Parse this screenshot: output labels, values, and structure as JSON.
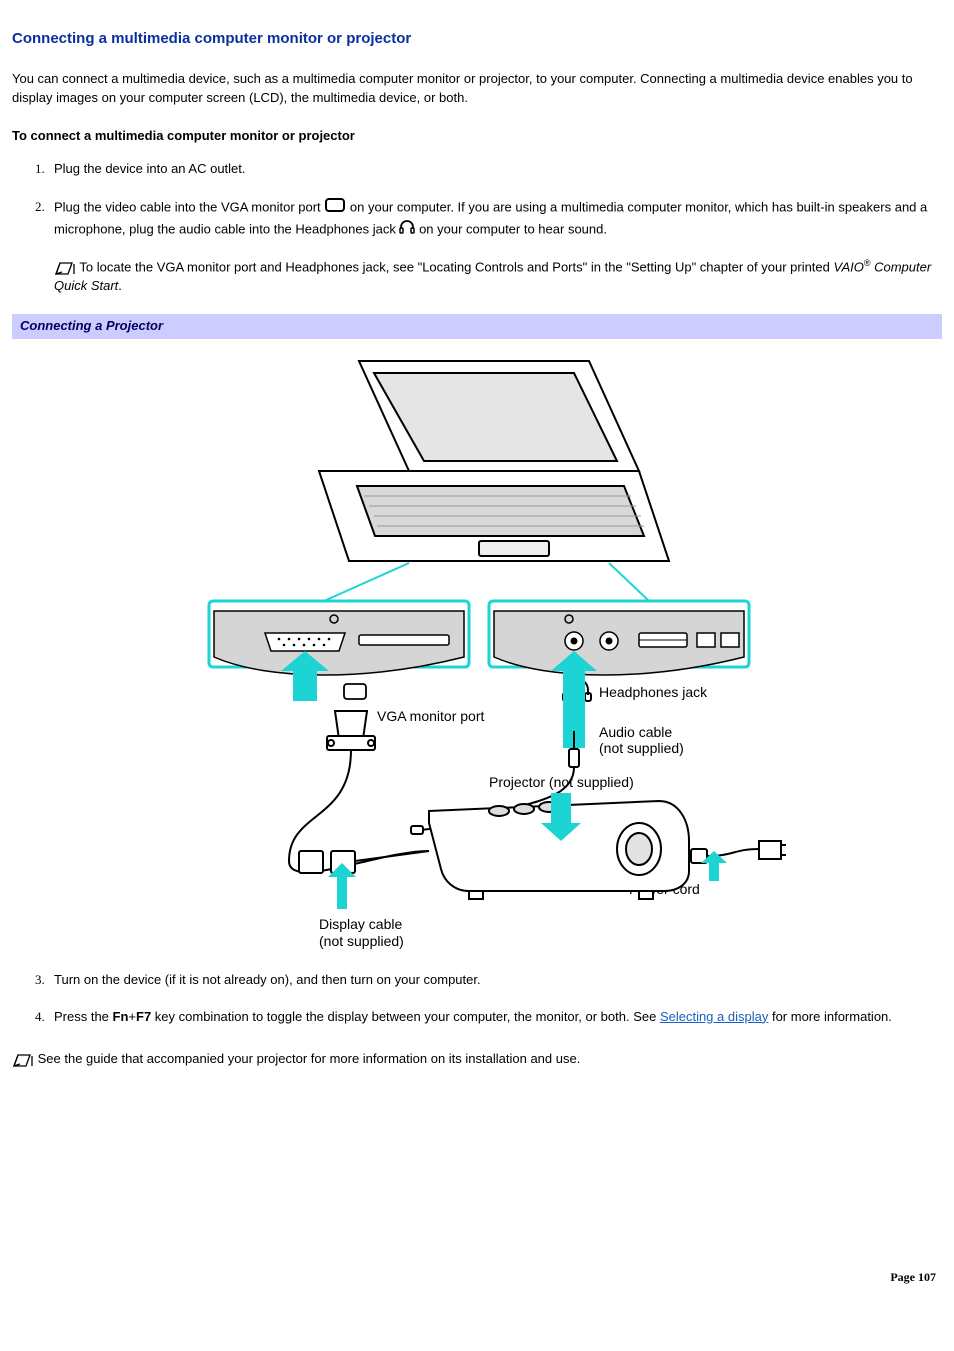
{
  "title": "Connecting a multimedia computer monitor or projector",
  "intro": "You can connect a multimedia device, such as a multimedia computer monitor or projector, to your computer. Connecting a multimedia device enables you to display images on your computer screen (LCD), the multimedia device, or both.",
  "subhead": "To connect a multimedia computer monitor or projector",
  "steps": {
    "s1": "Plug the device into an AC outlet.",
    "s2a": "Plug the video cable into the VGA monitor port ",
    "s2b": " on your computer. If you are using a multimedia computer monitor, which has built-in speakers and a microphone, plug the audio cable into the Headphones jack ",
    "s2c": " on your computer to hear sound.",
    "s2_note_a": " To locate the VGA monitor port and Headphones jack, see \"Locating Controls and Ports\" in the \"Setting Up\" chapter of your printed ",
    "s2_note_b": "VAIO",
    "s2_note_c": " Computer Quick Start",
    "s2_note_d": ".",
    "s3": "Turn on the device (if it is not already on), and then turn on your computer.",
    "s4a": "Press the ",
    "s4b": "Fn",
    "s4c": "+",
    "s4d": "F7",
    "s4e": " key combination to toggle the display between your computer, the monitor, or both. See ",
    "s4_link": "Selecting a display",
    "s4f": " for more information."
  },
  "caption": "Connecting a Projector",
  "labels": {
    "vga": "VGA monitor port",
    "hp": "Headphones jack",
    "audio1": "Audio cable",
    "audio2": "(not supplied)",
    "proj": "Projector (not supplied)",
    "power": "Power cord",
    "disp1": "Display cable",
    "disp2": "(not supplied)"
  },
  "bottom_note": " See the guide that accompanied your projector for more information on its installation and use.",
  "page_number": "Page 107"
}
